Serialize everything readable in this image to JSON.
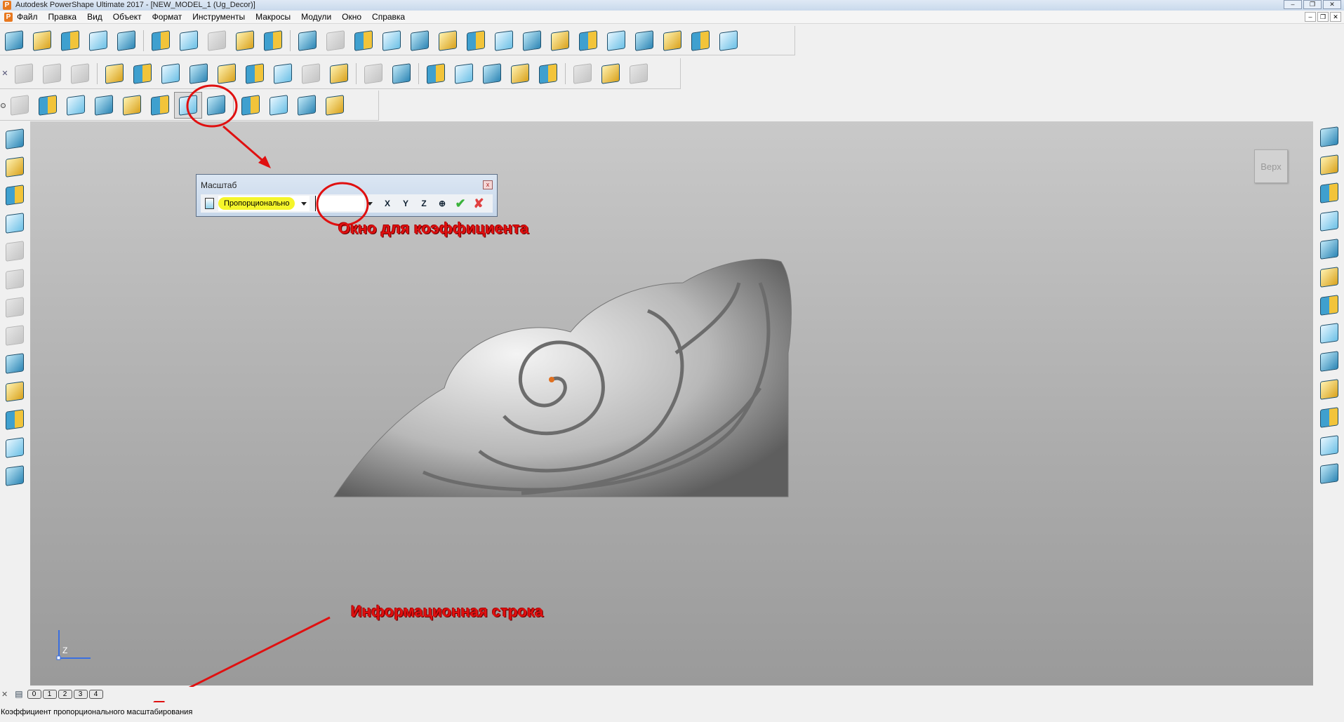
{
  "title_bar": {
    "logo": "P",
    "title": "Autodesk PowerShape Ultimate 2017 - [NEW_MODEL_1 (Ug_Decor)]",
    "buttons": [
      "–",
      "❐",
      "✕"
    ]
  },
  "menu": {
    "items": [
      "Файл",
      "Правка",
      "Вид",
      "Объект",
      "Формат",
      "Инструменты",
      "Макросы",
      "Модули",
      "Окно",
      "Справка"
    ],
    "mdi_buttons": [
      "–",
      "❐",
      "✕"
    ]
  },
  "toolbar_main": {
    "icons": [
      "new-file-icon",
      "open-folder-icon",
      "import-icon",
      "save-icon",
      "print-icon",
      "|",
      "cut-icon",
      "copy-icon",
      "paste-icon",
      "brush-icon",
      "delete-icon",
      "|",
      "undo-icon",
      "redo-icon",
      "sketch-icon",
      "render-icon",
      "workplane-icon",
      "axes-icon",
      "line-icon",
      "circle-icon",
      "curve-icon",
      "text-icon",
      "arc-curve-icon",
      "surface-icon",
      "solid-icon",
      "assembly-icon",
      "wizard-icon",
      "tool-icon"
    ]
  },
  "toolbar_surfaces": {
    "icons": [
      "close-icon",
      "level-icon",
      "layer-icon",
      "cylinder-icon",
      "|",
      "pyramid-icon",
      "extrude-icon",
      "morph-icon",
      "morph2-icon",
      "mesh-icon",
      "offset-icon",
      "shade-icon",
      "smart-icon",
      "pyramid-gold-icon",
      "|",
      "mirror-icon",
      "convert-icon",
      "|",
      "add-point-icon",
      "sphere-icon",
      "plane-icon",
      "arrow-icon",
      "z-axis-icon",
      "|",
      "hat-icon",
      "star-icon",
      "disabled-icon"
    ]
  },
  "toolbar_edit": {
    "icons": [
      "grip",
      "box-outline-icon",
      "transform-xy-icon",
      "move-icon",
      "rotate-icon",
      "mirror-solid-icon",
      "offset-box-icon",
      "scale-icon",
      "multi-copy-icon",
      "|",
      "project-icon",
      "drape-icon",
      "shade-ball-icon",
      "pyramid-hand-icon"
    ],
    "active": "scale-icon"
  },
  "left_toolbar": {
    "icons": [
      "select-arrow-icon",
      "selection-tool-icon",
      "warning-icon",
      "measure-icon",
      "split-icon",
      "join-icon",
      "curve-tool-icon",
      "repair-icon",
      "fill-icon",
      "analyse-icon",
      "zoom-analyse-icon",
      "section-icon",
      "health-check-icon"
    ]
  },
  "right_toolbar": {
    "icons": [
      "view-top-icon",
      "view-front-icon",
      "view-right-icon",
      "view-iso-icon",
      "view-camera-icon",
      "undo-view-icon",
      "rotate-view-icon",
      "zoom-fit-icon",
      "zoom-box-icon",
      "wireframe-icon",
      "shaded-icon",
      "plane-shade-icon",
      "lighting-icon"
    ]
  },
  "viewport": {
    "view_label": "Верх",
    "axis_label": "Z"
  },
  "scale_dialog": {
    "title": "Масштаб",
    "mode": "Пропорционально",
    "factor_value": "",
    "buttons": [
      "X",
      "Y",
      "Z",
      "center",
      "✔",
      "✘"
    ]
  },
  "annotations": {
    "factor_window": "Окно для коэффициента",
    "info_line": "Информационная строка"
  },
  "layer_bar": {
    "layers": [
      "0",
      "1",
      "2",
      "3",
      "4"
    ]
  },
  "status": {
    "text": "Коэффициент пропорционального масштабирования"
  },
  "colors": {
    "annotation": "#e01010",
    "highlight": "#f5f52a",
    "viewport_top": "#c9c9c9",
    "viewport_bottom": "#9a9a9a"
  }
}
